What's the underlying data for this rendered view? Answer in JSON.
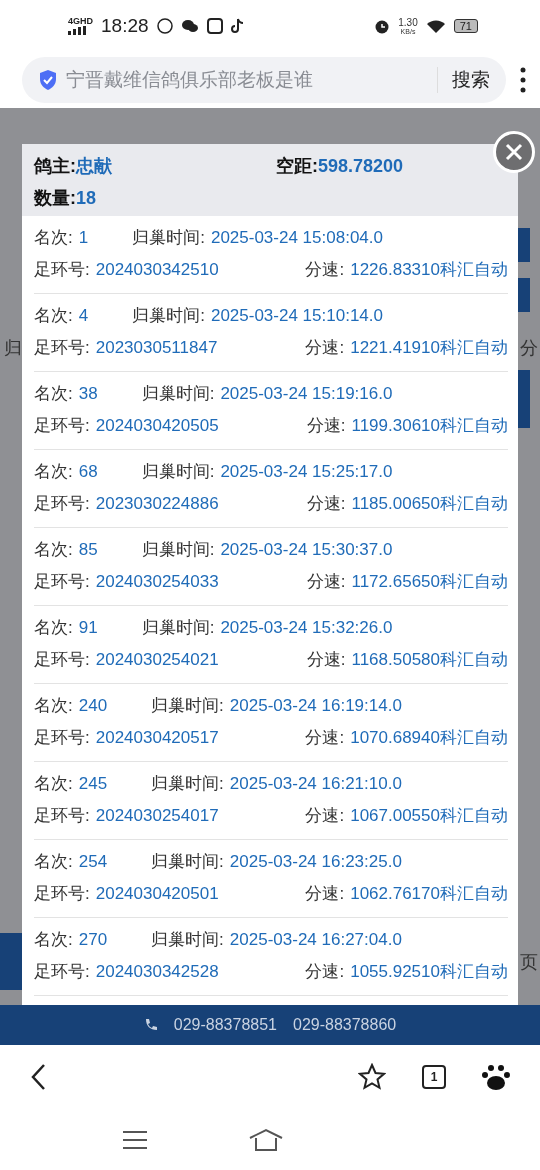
{
  "status_bar": {
    "network": "4G",
    "network_badge": "HD",
    "time": "18:28",
    "speed": "1.30",
    "speed_unit": "KB/s",
    "battery": "71"
  },
  "address_bar": {
    "query": "宁晋戴维信鸽俱乐部老板是谁",
    "button": "搜索"
  },
  "background": {
    "left_fragment": "归",
    "right_fragment": "分",
    "lower_fragment": "页"
  },
  "modal": {
    "owner_label": "鸽主:",
    "owner": "忠献",
    "distance_label": "空距:",
    "distance": "598.78200",
    "count_label": "数量:",
    "count": "18",
    "records": [
      {
        "rank_label": "名次:",
        "rank": "1",
        "time_label": "归巢时间:",
        "time": "2025-03-24 15:08:04.0",
        "ring_label": "足环号:",
        "ring": "2024030342510",
        "speed_label": "分速:",
        "speed": "1226.83310科汇自动"
      },
      {
        "rank_label": "名次:",
        "rank": "4",
        "time_label": "归巢时间:",
        "time": "2025-03-24 15:10:14.0",
        "ring_label": "足环号:",
        "ring": "2023030511847",
        "speed_label": "分速:",
        "speed": "1221.41910科汇自动"
      },
      {
        "rank_label": "名次:",
        "rank": "38",
        "time_label": "归巢时间:",
        "time": "2025-03-24 15:19:16.0",
        "ring_label": "足环号:",
        "ring": "2024030420505",
        "speed_label": "分速:",
        "speed": "1199.30610科汇自动"
      },
      {
        "rank_label": "名次:",
        "rank": "68",
        "time_label": "归巢时间:",
        "time": "2025-03-24 15:25:17.0",
        "ring_label": "足环号:",
        "ring": "2023030224886",
        "speed_label": "分速:",
        "speed": "1185.00650科汇自动"
      },
      {
        "rank_label": "名次:",
        "rank": "85",
        "time_label": "归巢时间:",
        "time": "2025-03-24 15:30:37.0",
        "ring_label": "足环号:",
        "ring": "2024030254033",
        "speed_label": "分速:",
        "speed": "1172.65650科汇自动"
      },
      {
        "rank_label": "名次:",
        "rank": "91",
        "time_label": "归巢时间:",
        "time": "2025-03-24 15:32:26.0",
        "ring_label": "足环号:",
        "ring": "2024030254021",
        "speed_label": "分速:",
        "speed": "1168.50580科汇自动"
      },
      {
        "rank_label": "名次:",
        "rank": "240",
        "time_label": "归巢时间:",
        "time": "2025-03-24 16:19:14.0",
        "ring_label": "足环号:",
        "ring": "2024030420517",
        "speed_label": "分速:",
        "speed": "1070.68940科汇自动"
      },
      {
        "rank_label": "名次:",
        "rank": "245",
        "time_label": "归巢时间:",
        "time": "2025-03-24 16:21:10.0",
        "ring_label": "足环号:",
        "ring": "2024030254017",
        "speed_label": "分速:",
        "speed": "1067.00550科汇自动"
      },
      {
        "rank_label": "名次:",
        "rank": "254",
        "time_label": "归巢时间:",
        "time": "2025-03-24 16:23:25.0",
        "ring_label": "足环号:",
        "ring": "2024030420501",
        "speed_label": "分速:",
        "speed": "1062.76170科汇自动"
      },
      {
        "rank_label": "名次:",
        "rank": "270",
        "time_label": "归巢时间:",
        "time": "2025-03-24 16:27:04.0",
        "ring_label": "足环号:",
        "ring": "2024030342528",
        "speed_label": "分速:",
        "speed": "1055.92510科汇自动"
      }
    ]
  },
  "footer": {
    "phones": [
      "029-88378851",
      "029-88378860"
    ]
  },
  "browser_nav": {
    "tab_count": "1"
  }
}
